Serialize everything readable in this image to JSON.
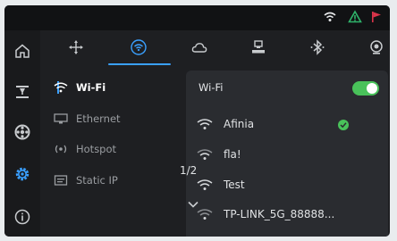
{
  "status_bar": {
    "icons": [
      "wifi-icon",
      "triangle-warning-icon",
      "flag-icon"
    ],
    "colors": {
      "warning": "#2fb36a",
      "flag": "#d9344a"
    }
  },
  "rail": {
    "items": [
      {
        "name": "home-icon",
        "active": false
      },
      {
        "name": "print-icon",
        "active": false
      },
      {
        "name": "filament-spool-icon",
        "active": false
      },
      {
        "name": "settings-icon",
        "active": true
      },
      {
        "name": "info-icon",
        "active": false
      }
    ]
  },
  "top_tabs": {
    "items": [
      "move-icon",
      "network-icon",
      "cloud-icon",
      "printer-icon",
      "bluetooth-icon",
      "camera-icon"
    ],
    "active_index": 1,
    "accent": "#3aa0ff"
  },
  "subnav": {
    "items": [
      {
        "label": "Wi-Fi",
        "icon": "wifi-icon",
        "active": true
      },
      {
        "label": "Ethernet",
        "icon": "ethernet-icon",
        "active": false
      },
      {
        "label": "Hotspot",
        "icon": "hotspot-icon",
        "active": false
      },
      {
        "label": "Static IP",
        "icon": "static-ip-icon",
        "active": false
      }
    ]
  },
  "panel": {
    "title": "Wi-Fi",
    "wifi_enabled": true,
    "networks": [
      {
        "ssid": "Afinia",
        "connected": true
      },
      {
        "ssid": "fla!",
        "connected": false
      },
      {
        "ssid": "Test",
        "connected": false
      },
      {
        "ssid": "TP-LINK_5G_88888...",
        "connected": false
      }
    ],
    "page_indicator": "1/2",
    "toggle_color": "#49c25a"
  }
}
